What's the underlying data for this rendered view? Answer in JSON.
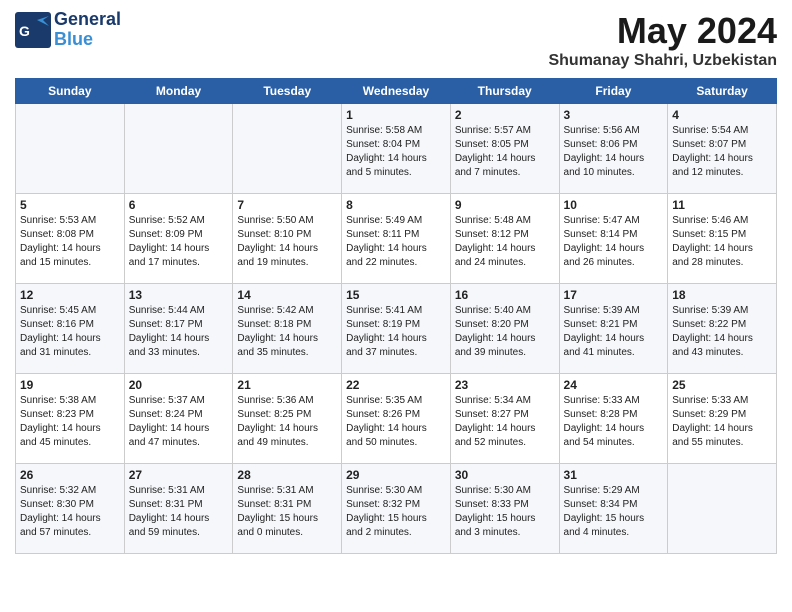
{
  "header": {
    "logo_general": "General",
    "logo_blue": "Blue",
    "month_year": "May 2024",
    "location": "Shumanay Shahri, Uzbekistan"
  },
  "weekdays": [
    "Sunday",
    "Monday",
    "Tuesday",
    "Wednesday",
    "Thursday",
    "Friday",
    "Saturday"
  ],
  "weeks": [
    [
      {
        "day": "",
        "content": ""
      },
      {
        "day": "",
        "content": ""
      },
      {
        "day": "",
        "content": ""
      },
      {
        "day": "1",
        "content": "Sunrise: 5:58 AM\nSunset: 8:04 PM\nDaylight: 14 hours\nand 5 minutes."
      },
      {
        "day": "2",
        "content": "Sunrise: 5:57 AM\nSunset: 8:05 PM\nDaylight: 14 hours\nand 7 minutes."
      },
      {
        "day": "3",
        "content": "Sunrise: 5:56 AM\nSunset: 8:06 PM\nDaylight: 14 hours\nand 10 minutes."
      },
      {
        "day": "4",
        "content": "Sunrise: 5:54 AM\nSunset: 8:07 PM\nDaylight: 14 hours\nand 12 minutes."
      }
    ],
    [
      {
        "day": "5",
        "content": "Sunrise: 5:53 AM\nSunset: 8:08 PM\nDaylight: 14 hours\nand 15 minutes."
      },
      {
        "day": "6",
        "content": "Sunrise: 5:52 AM\nSunset: 8:09 PM\nDaylight: 14 hours\nand 17 minutes."
      },
      {
        "day": "7",
        "content": "Sunrise: 5:50 AM\nSunset: 8:10 PM\nDaylight: 14 hours\nand 19 minutes."
      },
      {
        "day": "8",
        "content": "Sunrise: 5:49 AM\nSunset: 8:11 PM\nDaylight: 14 hours\nand 22 minutes."
      },
      {
        "day": "9",
        "content": "Sunrise: 5:48 AM\nSunset: 8:12 PM\nDaylight: 14 hours\nand 24 minutes."
      },
      {
        "day": "10",
        "content": "Sunrise: 5:47 AM\nSunset: 8:14 PM\nDaylight: 14 hours\nand 26 minutes."
      },
      {
        "day": "11",
        "content": "Sunrise: 5:46 AM\nSunset: 8:15 PM\nDaylight: 14 hours\nand 28 minutes."
      }
    ],
    [
      {
        "day": "12",
        "content": "Sunrise: 5:45 AM\nSunset: 8:16 PM\nDaylight: 14 hours\nand 31 minutes."
      },
      {
        "day": "13",
        "content": "Sunrise: 5:44 AM\nSunset: 8:17 PM\nDaylight: 14 hours\nand 33 minutes."
      },
      {
        "day": "14",
        "content": "Sunrise: 5:42 AM\nSunset: 8:18 PM\nDaylight: 14 hours\nand 35 minutes."
      },
      {
        "day": "15",
        "content": "Sunrise: 5:41 AM\nSunset: 8:19 PM\nDaylight: 14 hours\nand 37 minutes."
      },
      {
        "day": "16",
        "content": "Sunrise: 5:40 AM\nSunset: 8:20 PM\nDaylight: 14 hours\nand 39 minutes."
      },
      {
        "day": "17",
        "content": "Sunrise: 5:39 AM\nSunset: 8:21 PM\nDaylight: 14 hours\nand 41 minutes."
      },
      {
        "day": "18",
        "content": "Sunrise: 5:39 AM\nSunset: 8:22 PM\nDaylight: 14 hours\nand 43 minutes."
      }
    ],
    [
      {
        "day": "19",
        "content": "Sunrise: 5:38 AM\nSunset: 8:23 PM\nDaylight: 14 hours\nand 45 minutes."
      },
      {
        "day": "20",
        "content": "Sunrise: 5:37 AM\nSunset: 8:24 PM\nDaylight: 14 hours\nand 47 minutes."
      },
      {
        "day": "21",
        "content": "Sunrise: 5:36 AM\nSunset: 8:25 PM\nDaylight: 14 hours\nand 49 minutes."
      },
      {
        "day": "22",
        "content": "Sunrise: 5:35 AM\nSunset: 8:26 PM\nDaylight: 14 hours\nand 50 minutes."
      },
      {
        "day": "23",
        "content": "Sunrise: 5:34 AM\nSunset: 8:27 PM\nDaylight: 14 hours\nand 52 minutes."
      },
      {
        "day": "24",
        "content": "Sunrise: 5:33 AM\nSunset: 8:28 PM\nDaylight: 14 hours\nand 54 minutes."
      },
      {
        "day": "25",
        "content": "Sunrise: 5:33 AM\nSunset: 8:29 PM\nDaylight: 14 hours\nand 55 minutes."
      }
    ],
    [
      {
        "day": "26",
        "content": "Sunrise: 5:32 AM\nSunset: 8:30 PM\nDaylight: 14 hours\nand 57 minutes."
      },
      {
        "day": "27",
        "content": "Sunrise: 5:31 AM\nSunset: 8:31 PM\nDaylight: 14 hours\nand 59 minutes."
      },
      {
        "day": "28",
        "content": "Sunrise: 5:31 AM\nSunset: 8:31 PM\nDaylight: 15 hours\nand 0 minutes."
      },
      {
        "day": "29",
        "content": "Sunrise: 5:30 AM\nSunset: 8:32 PM\nDaylight: 15 hours\nand 2 minutes."
      },
      {
        "day": "30",
        "content": "Sunrise: 5:30 AM\nSunset: 8:33 PM\nDaylight: 15 hours\nand 3 minutes."
      },
      {
        "day": "31",
        "content": "Sunrise: 5:29 AM\nSunset: 8:34 PM\nDaylight: 15 hours\nand 4 minutes."
      },
      {
        "day": "",
        "content": ""
      }
    ]
  ]
}
